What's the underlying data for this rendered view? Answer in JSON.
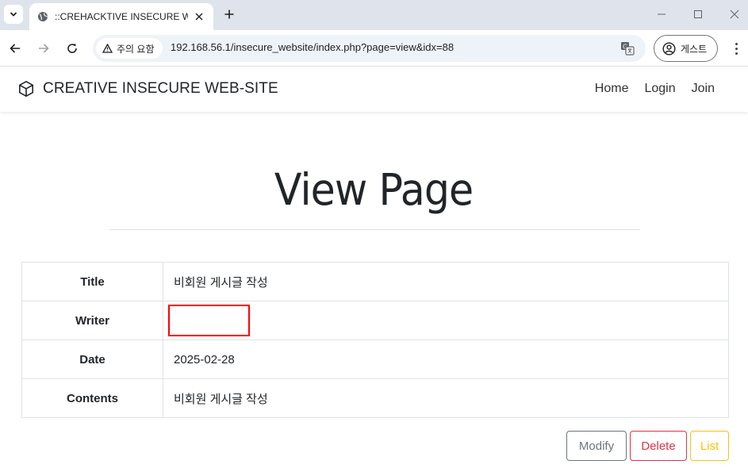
{
  "browser": {
    "tab_title": "::CREHACKTIVE INSECURE WEB",
    "security_chip": "주의 요함",
    "url": "192.168.56.1/insecure_website/index.php?page=view&idx=88",
    "profile_label": "게스트"
  },
  "navbar": {
    "brand": "CREATIVE INSECURE WEB-SITE",
    "brand_icon": "cube-icon",
    "links": [
      "Home",
      "Login",
      "Join"
    ]
  },
  "page": {
    "heading": "View Page"
  },
  "post": {
    "rows": [
      {
        "label": "Title",
        "value": "비회원 게시글 작성"
      },
      {
        "label": "Writer",
        "value": ""
      },
      {
        "label": "Date",
        "value": "2025-02-28"
      },
      {
        "label": "Contents",
        "value": "비회원 게시글 작성"
      }
    ]
  },
  "actions": {
    "modify": "Modify",
    "delete": "Delete",
    "list": "List"
  },
  "colors": {
    "modify": "#6c757d",
    "delete": "#dc3545",
    "list": "#ffc107",
    "highlight_box": "#ff0000"
  }
}
